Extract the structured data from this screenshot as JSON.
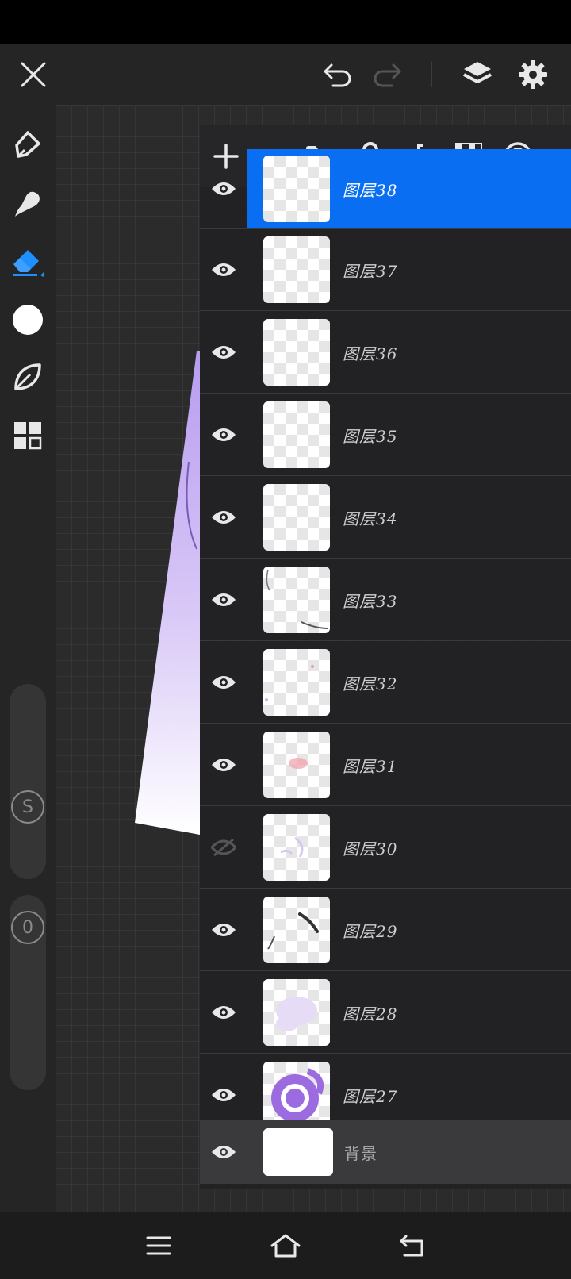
{
  "colors": {
    "accent": "#0a6ef2",
    "toolbar_bg": "#252525",
    "panel_bg": "#212123",
    "active_tool": "#1e8fff",
    "icon": "#e8e8e8",
    "icon_dim": "#555555"
  },
  "topbar": {
    "close_icon": "close-icon",
    "undo_icon": "undo-icon",
    "redo_icon": "redo-icon",
    "layers_icon": "layers-icon",
    "settings_icon": "gear-icon"
  },
  "tools": [
    {
      "name": "pen-tool",
      "icon": "pen-icon",
      "active": false
    },
    {
      "name": "smudge-tool",
      "icon": "smudge-icon",
      "active": false
    },
    {
      "name": "eraser-tool",
      "icon": "eraser-icon",
      "active": true
    },
    {
      "name": "color-picker",
      "icon": "color-dot-icon",
      "active": false
    },
    {
      "name": "leaf-tool",
      "icon": "leaf-icon",
      "active": false
    },
    {
      "name": "gallery-tool",
      "icon": "grid-icon",
      "active": false
    }
  ],
  "sliders": {
    "size_label": "S",
    "opacity_label": "0"
  },
  "layer_panel": {
    "toolbar": [
      "add-icon",
      "folder-icon",
      "lock-icon",
      "merge-down-icon",
      "checker-icon",
      "target-icon"
    ],
    "layers": [
      {
        "name": "图层38",
        "visible": true,
        "selected": true
      },
      {
        "name": "图层37",
        "visible": true,
        "selected": false
      },
      {
        "name": "图层36",
        "visible": true,
        "selected": false
      },
      {
        "name": "图层35",
        "visible": true,
        "selected": false
      },
      {
        "name": "图层34",
        "visible": true,
        "selected": false
      },
      {
        "name": "图层33",
        "visible": true,
        "selected": false
      },
      {
        "name": "图层32",
        "visible": true,
        "selected": false
      },
      {
        "name": "图层31",
        "visible": true,
        "selected": false
      },
      {
        "name": "图层30",
        "visible": false,
        "selected": false
      },
      {
        "name": "图层29",
        "visible": true,
        "selected": false
      },
      {
        "name": "图层28",
        "visible": true,
        "selected": false
      },
      {
        "name": "图层27",
        "visible": true,
        "selected": false
      }
    ],
    "background_layer": {
      "name": "背景",
      "visible": true
    }
  },
  "navbar": {
    "menu_icon": "menu-icon",
    "home_icon": "home-icon",
    "back_icon": "back-icon"
  }
}
